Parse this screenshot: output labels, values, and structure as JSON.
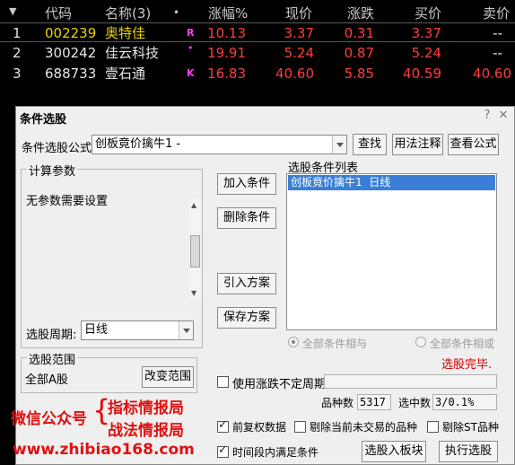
{
  "stock_table": {
    "headers": {
      "sort_arrow": "▼",
      "code": "代码",
      "name": "名称(3)",
      "dot": "•",
      "change_pct": "涨幅%",
      "price": "现价",
      "change": "涨跌",
      "bid": "买价",
      "ask": "卖价"
    },
    "rows": [
      {
        "idx": "1",
        "code": "002239",
        "name": "奥特佳",
        "flag": "R",
        "change_pct": "10.13",
        "price": "3.37",
        "change": "0.31",
        "bid": "3.37",
        "ask": "--"
      },
      {
        "idx": "2",
        "code": "300242",
        "name": "佳云科技",
        "flag": "•",
        "change_pct": "19.91",
        "price": "5.24",
        "change": "0.87",
        "bid": "5.24",
        "ask": "--"
      },
      {
        "idx": "3",
        "code": "688733",
        "name": "壹石通",
        "flag": "K",
        "change_pct": "16.83",
        "price": "40.60",
        "change": "5.85",
        "bid": "40.59",
        "ask": "40.60"
      }
    ]
  },
  "dialog": {
    "title": "条件选股",
    "help_icon": "?",
    "close_icon": "✕",
    "formula_label": "条件选股公式",
    "formula_value": "创板竟价擒牛1 -",
    "btn_find": "查找",
    "btn_usage": "用法注释",
    "btn_view": "查看公式",
    "params_group": "计算参数",
    "params_text": "无参数需要设置",
    "period_label": "选股周期:",
    "period_value": "日线",
    "btn_add": "加入条件",
    "btn_delete": "删除条件",
    "btn_import": "引入方案",
    "btn_save": "保存方案",
    "list_label": "选股条件列表",
    "list_items": [
      {
        "text": "创板竟价擒牛1  日线"
      }
    ],
    "radio_and": "全部条件相与",
    "radio_or": "全部条件相或",
    "status_text": "选股完毕.",
    "range_group": "选股范围",
    "range_value": "全部A股",
    "btn_change_range": "改变范围",
    "chk_variable_period": "使用涨跌不定周期",
    "count_label": "品种数",
    "count_value": "5317",
    "selected_label": "选中数",
    "selected_value": "3/0.1%",
    "chk_rights": "前复权数据",
    "chk_exclude_untraded": "剔除当前未交易的品种",
    "chk_exclude_st": "剔除ST品种",
    "chk_time_range": "时间段内满足条件",
    "btn_to_block": "选股入板块",
    "btn_execute": "执行选股"
  },
  "watermark": {
    "wechat_label": "微信公众号",
    "line1": "指标情报局",
    "line2": "战法情报局",
    "url": "www.zhibiao168.com"
  },
  "colors": {
    "accent_red": "#ff3c3c",
    "code_yellow": "#e8d200",
    "list_selection": "#3a7fd5",
    "status_red": "#d00000"
  }
}
